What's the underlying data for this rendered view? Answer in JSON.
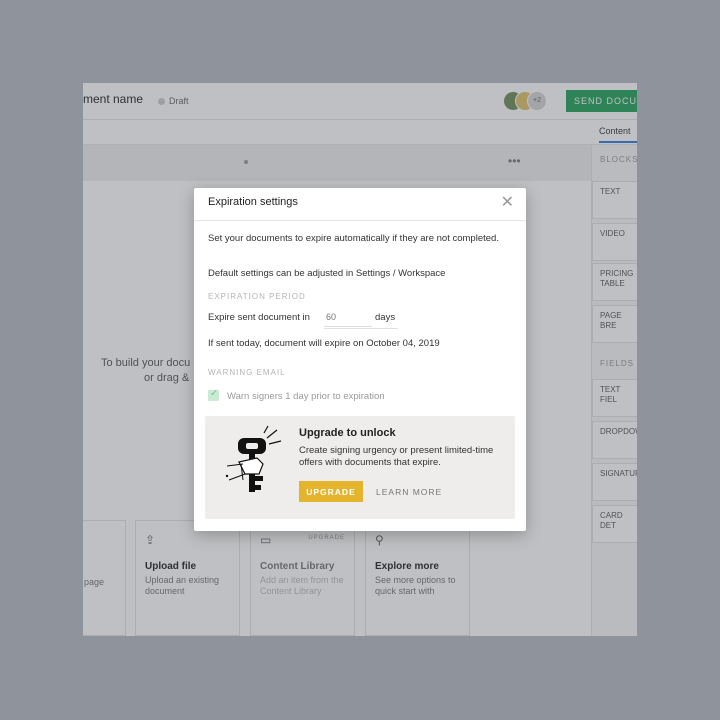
{
  "document": {
    "title": "ment name",
    "status": "Draft",
    "send_button": "SEND DOCUM",
    "avatars": [
      "",
      "",
      "+2"
    ]
  },
  "tabs": {
    "content": "Content"
  },
  "canvas": {
    "line1": "To build your docu",
    "line2": "or drag &"
  },
  "sidebar": {
    "blocks_label": "BLOCKS",
    "blocks": [
      "TEXT",
      "VIDEO",
      "PRICING TABLE",
      "PAGE BRE"
    ],
    "fields_label": "FIELDS",
    "fields": [
      "TEXT FIEL",
      "DROPDOW",
      "SIGNATUR",
      "CARD DET"
    ]
  },
  "cards": [
    {
      "title": "",
      "desc": "page",
      "icon": "",
      "badge": ""
    },
    {
      "title": "Upload file",
      "desc": "Upload an existing document",
      "icon": "upload-icon",
      "badge": ""
    },
    {
      "title": "Content Library",
      "desc": "Add an item from the Content Library",
      "icon": "library-icon",
      "badge": "UPGRADE"
    },
    {
      "title": "Explore more",
      "desc": "See more options to quick start with",
      "icon": "search-icon",
      "badge": ""
    }
  ],
  "modal": {
    "title": "Expiration settings",
    "intro": "Set your documents to expire automatically if they are not completed.",
    "defaults_note": "Default settings can be adjusted in Settings / Workspace",
    "period_section": "EXPIRATION PERIOD",
    "expire_label": "Expire sent document in",
    "days_placeholder": "60",
    "days_label": "days",
    "expire_note": "If sent today, document will expire on October 04, 2019",
    "warning_section": "WARNING EMAIL",
    "warn_label": "Warn signers 1 day prior to expiration",
    "warn_checked": true,
    "upgrade": {
      "title": "Upgrade to unlock",
      "text": "Create signing urgency or present limited-time offers with documents that expire.",
      "button": "UPGRADE",
      "learn_more": "LEARN MORE"
    }
  },
  "colors": {
    "accent_green": "#24a35a",
    "upgrade_yellow": "#e4b52c",
    "tab_blue": "#2d7ee3",
    "backdrop": "#8e939c"
  }
}
